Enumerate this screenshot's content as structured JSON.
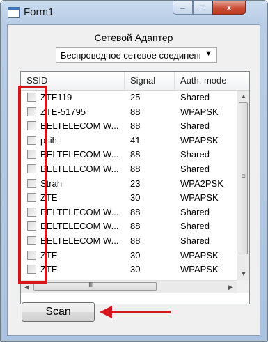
{
  "window": {
    "title": "Form1",
    "buttons": {
      "minimize": "–",
      "maximize": "□",
      "close": "x"
    }
  },
  "adapter": {
    "label": "Сетевой Адаптер",
    "selected": "Беспроводное сетевое соединени"
  },
  "table": {
    "columns": [
      "SSID",
      "Signal",
      "Auth. mode"
    ],
    "rows": [
      {
        "ssid": "ZTE119",
        "signal": "25",
        "auth": "Shared"
      },
      {
        "ssid": "ZTE-51795",
        "signal": "88",
        "auth": "WPAPSK"
      },
      {
        "ssid": "BELTELECOM W...",
        "signal": "88",
        "auth": "Shared"
      },
      {
        "ssid": "psih",
        "signal": "41",
        "auth": "WPAPSK"
      },
      {
        "ssid": "BELTELECOM W...",
        "signal": "88",
        "auth": "Shared"
      },
      {
        "ssid": "BELTELECOM W...",
        "signal": "88",
        "auth": "Shared"
      },
      {
        "ssid": "Strah",
        "signal": "23",
        "auth": "WPA2PSK"
      },
      {
        "ssid": "ZTE",
        "signal": "30",
        "auth": "WPAPSK"
      },
      {
        "ssid": "BELTELECOM W...",
        "signal": "88",
        "auth": "Shared"
      },
      {
        "ssid": "BELTELECOM W...",
        "signal": "88",
        "auth": "Shared"
      },
      {
        "ssid": "BELTELECOM W...",
        "signal": "88",
        "auth": "Shared"
      },
      {
        "ssid": "ZTE",
        "signal": "30",
        "auth": "WPAPSK"
      },
      {
        "ssid": "ZTE",
        "signal": "30",
        "auth": "WPAPSK"
      }
    ]
  },
  "scan_button": "Scan",
  "icons": {
    "scroll_up": "▲",
    "scroll_down": "▼",
    "scroll_left": "◀",
    "scroll_right": "▶",
    "grip_v": "≡",
    "grip_h": "III",
    "dropdown": "▼"
  },
  "colors": {
    "highlight": "#d6161b"
  }
}
